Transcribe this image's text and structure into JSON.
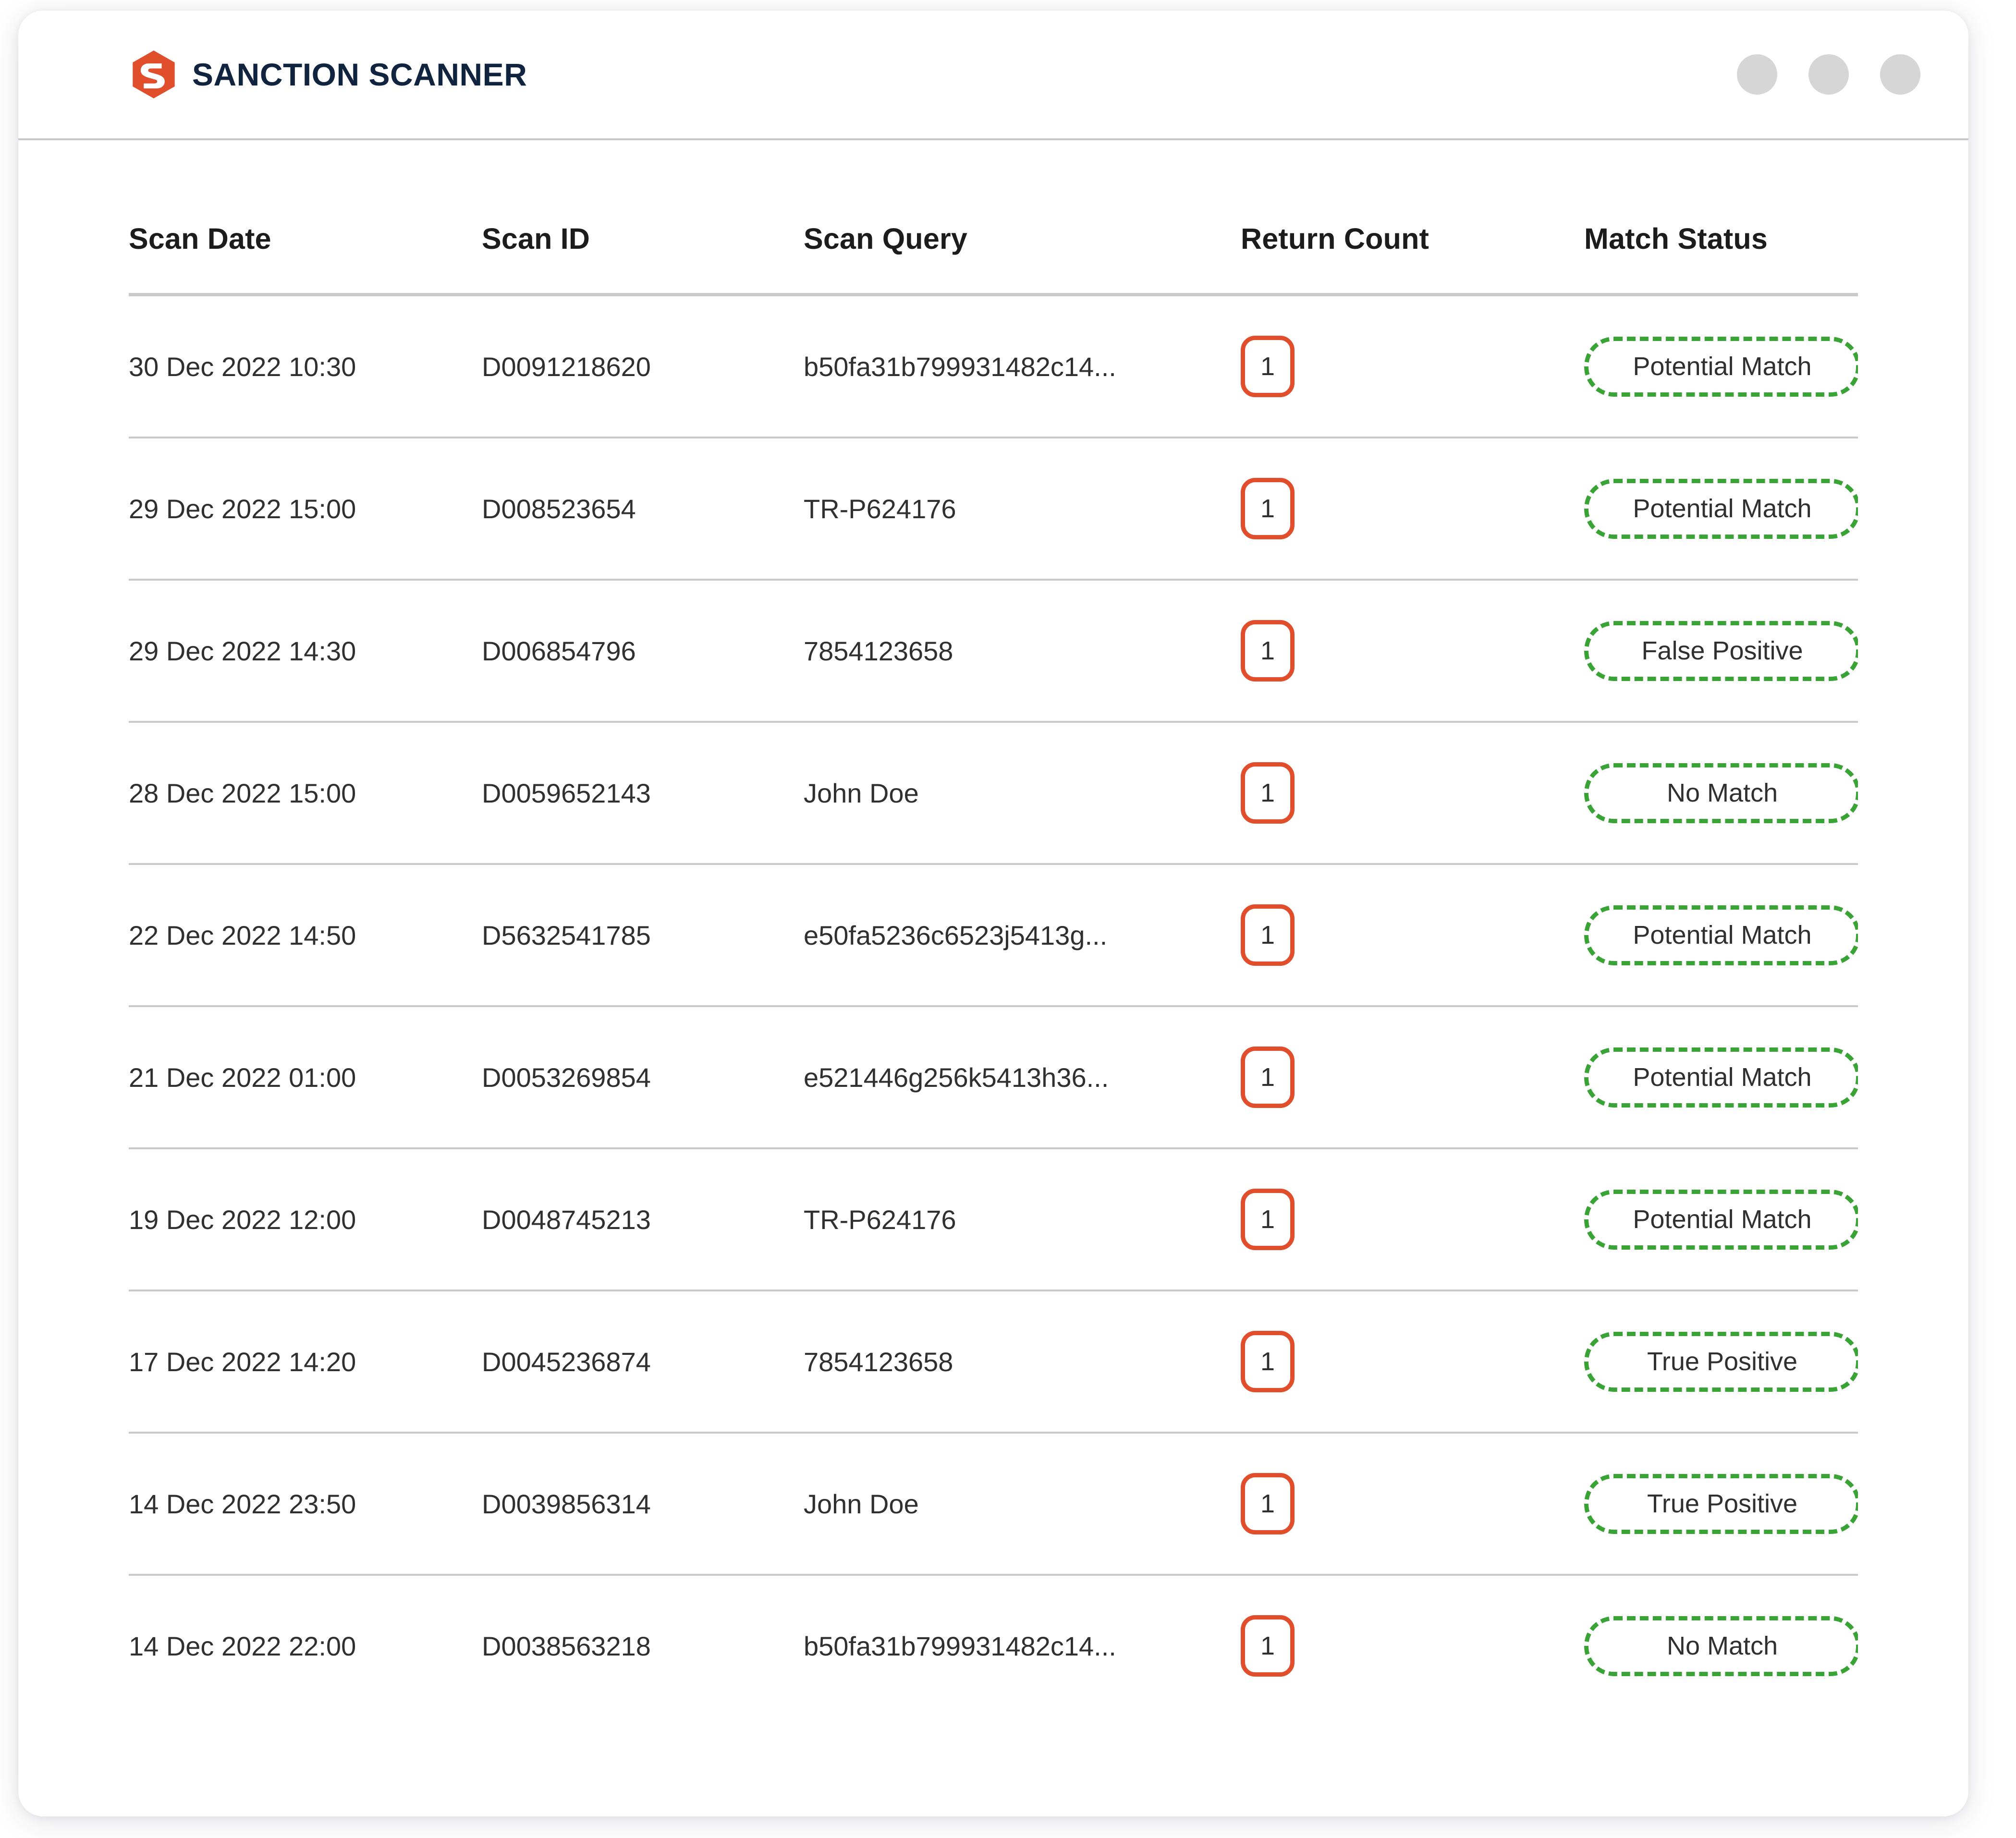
{
  "window": {
    "brand_name": "SANCTION SCANNER",
    "logo_icon": "sanction-scanner-logo",
    "dots": [
      "window-dot-1",
      "window-dot-2",
      "window-dot-3"
    ]
  },
  "colors": {
    "brand_orange": "#e04e2b",
    "brand_navy": "#10243f",
    "status_green": "#3aa335",
    "divider_gray": "#c9c9cd",
    "dot_gray": "#d6d6d6",
    "text_dark": "#303030"
  },
  "table": {
    "columns": [
      {
        "key": "scan_date",
        "label": "Scan Date"
      },
      {
        "key": "scan_id",
        "label": "Scan ID"
      },
      {
        "key": "scan_query",
        "label": "Scan Query"
      },
      {
        "key": "return_count",
        "label": "Return Count"
      },
      {
        "key": "match_status",
        "label": "Match Status"
      }
    ],
    "rows": [
      {
        "scan_date": "30 Dec 2022 10:30",
        "scan_id": "D0091218620",
        "scan_query": "b50fa31b799931482c14...",
        "return_count": "1",
        "match_status": "Potential Match"
      },
      {
        "scan_date": "29 Dec 2022 15:00",
        "scan_id": "D008523654",
        "scan_query": "TR-P624176",
        "return_count": "1",
        "match_status": "Potential Match"
      },
      {
        "scan_date": "29 Dec 2022 14:30",
        "scan_id": "D006854796",
        "scan_query": "7854123658",
        "return_count": "1",
        "match_status": "False Positive"
      },
      {
        "scan_date": "28 Dec 2022 15:00",
        "scan_id": "D0059652143",
        "scan_query": "John Doe",
        "return_count": "1",
        "match_status": "No Match"
      },
      {
        "scan_date": "22 Dec 2022 14:50",
        "scan_id": "D5632541785",
        "scan_query": "e50fa5236c6523j5413g...",
        "return_count": "1",
        "match_status": "Potential Match"
      },
      {
        "scan_date": "21 Dec 2022 01:00",
        "scan_id": "D0053269854",
        "scan_query": "e521446g256k5413h36...",
        "return_count": "1",
        "match_status": "Potential Match"
      },
      {
        "scan_date": "19 Dec 2022 12:00",
        "scan_id": "D0048745213",
        "scan_query": "TR-P624176",
        "return_count": "1",
        "match_status": "Potential Match"
      },
      {
        "scan_date": "17 Dec 2022 14:20",
        "scan_id": "D0045236874",
        "scan_query": "7854123658",
        "return_count": "1",
        "match_status": "True Positive"
      },
      {
        "scan_date": "14 Dec 2022 23:50",
        "scan_id": "D0039856314",
        "scan_query": "John Doe",
        "return_count": "1",
        "match_status": "True Positive"
      },
      {
        "scan_date": "14 Dec 2022 22:00",
        "scan_id": "D0038563218",
        "scan_query": "b50fa31b799931482c14...",
        "return_count": "1",
        "match_status": "No Match"
      }
    ]
  }
}
